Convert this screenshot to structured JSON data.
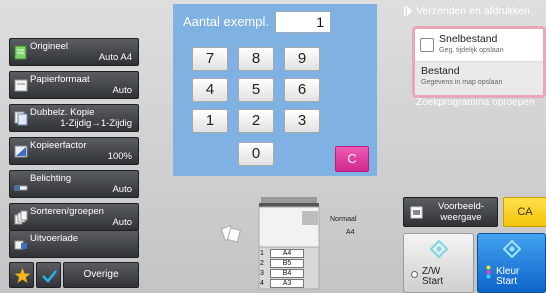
{
  "copies": {
    "label": "Aantal exempl.",
    "value": "1"
  },
  "keypad": {
    "keys": [
      "7",
      "8",
      "9",
      "4",
      "5",
      "6",
      "1",
      "2",
      "3",
      "0"
    ],
    "clear": "C"
  },
  "settings": [
    {
      "name": "Origineel",
      "value": "Auto  A4"
    },
    {
      "name": "Papierformaat",
      "value": "Auto"
    },
    {
      "name": "Dubbelz. Kopie",
      "value": "1-Zijdig→1-Zijdig"
    },
    {
      "name": "Kopieerfactor",
      "value": "100%"
    },
    {
      "name": "Belichting",
      "value": "Auto"
    },
    {
      "name": "Sorteren/groepen",
      "value": "Auto"
    },
    {
      "name": "Uitvoerlade",
      "value": ""
    }
  ],
  "bottom_bar": {
    "overige": "Overige"
  },
  "right_panel": {
    "title": "Verzenden en afdrukken",
    "popup": {
      "option1_title": "Snelbestand",
      "option1_sub": "Geg. tijdelijk opslaan",
      "option2_title": "Bestand",
      "option2_sub": "Gegevens in map opslaan"
    },
    "behind_text": "Zoekprogramma oproepen",
    "preview_label": "Voorbeeld-\nweergave",
    "ca_label": "CA",
    "start_bw_label": "Z/W\nStart",
    "start_color_label": "Kleur\nStart"
  },
  "machine": {
    "paper_type": "Normaal",
    "paper_size": "A4",
    "trays": [
      {
        "num": "1",
        "size": "A4"
      },
      {
        "num": "2",
        "size": "B5"
      },
      {
        "num": "3",
        "size": "B4"
      },
      {
        "num": "4",
        "size": "A3"
      }
    ]
  },
  "colors": {
    "keypad_bg": "#7fb1e2",
    "clear_key": "#e03aa0",
    "ca_button": "#f5cc1d",
    "color_start": "#1b7de0",
    "popup_border": "#e8a6b6"
  }
}
